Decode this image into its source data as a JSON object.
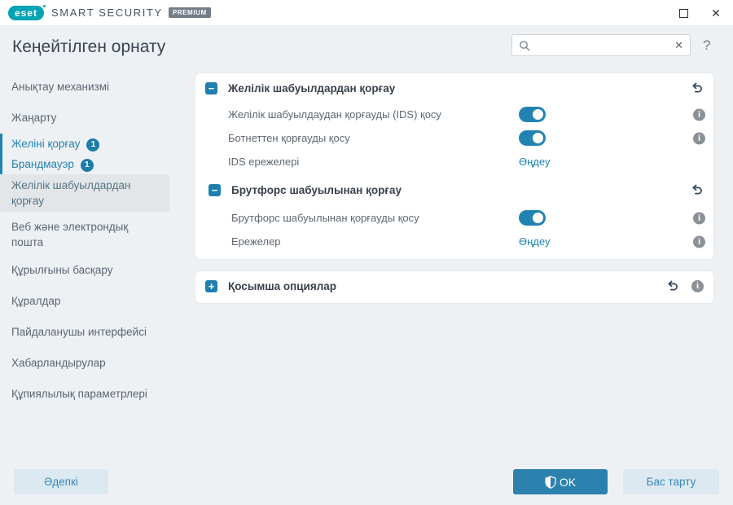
{
  "titlebar": {
    "logo_text": "eset",
    "brand": "SMART SECURITY",
    "badge": "PREMIUM"
  },
  "icons": {
    "close_glyph": "✕",
    "clear_glyph": "✕",
    "minus_glyph": "−",
    "plus_glyph": "+",
    "info_glyph": "i",
    "help_glyph": "?"
  },
  "header": {
    "title": "Кеңейтілген орнату",
    "search_placeholder": ""
  },
  "sidebar": {
    "items": [
      {
        "label": "Анықтау механизмі"
      },
      {
        "label": "Жаңарту"
      },
      {
        "label": "Желіні қорғау",
        "badge": "1"
      },
      {
        "label": "Брандмауэр",
        "badge": "1"
      },
      {
        "label": "Желілік шабуылдардан қорғау"
      },
      {
        "label": "Веб және электрондық пошта"
      },
      {
        "label": "Құрылғыны басқару"
      },
      {
        "label": "Құралдар"
      },
      {
        "label": "Пайдаланушы интерфейсі"
      },
      {
        "label": "Хабарландырулар"
      },
      {
        "label": "Құпиялылық параметрлері"
      }
    ]
  },
  "main": {
    "section1": {
      "title": "Желілік шабуылдардан қорғау",
      "rows": [
        {
          "label": "Желілік шабуылдаудан қорғауды (IDS) қосу",
          "control": "toggle-on"
        },
        {
          "label": "Ботнеттен қорғауды қосу",
          "control": "toggle-on"
        },
        {
          "label": "IDS ережелері",
          "control": "link",
          "link_label": "Өңдеу"
        }
      ],
      "subsection": {
        "title": "Брутфорс шабуылынан қорғау",
        "rows": [
          {
            "label": "Брутфорс шабуылынан қорғауды қосу",
            "control": "toggle-on"
          },
          {
            "label": "Ережелер",
            "control": "link",
            "link_label": "Өңдеу"
          }
        ]
      }
    },
    "section2": {
      "title": "Қосымша опциялар"
    }
  },
  "footer": {
    "default_label": "Әдепкі",
    "ok_label": "OK",
    "cancel_label": "Бас тарту"
  },
  "colors": {
    "accent_blue": "#2283b2",
    "toggle_blue": "#2283b2",
    "badge_blue": "#1e7ca9",
    "logo_teal": "#00a4b4",
    "ok_button": "#2b80ae",
    "light_button": "#dde9f1",
    "window_bg": "#eef1f4",
    "card_bg": "#ffffff",
    "selected_item_bg": "#e3e6e9",
    "undo_icon": "#31465a",
    "info_icon": "#8b9198"
  }
}
